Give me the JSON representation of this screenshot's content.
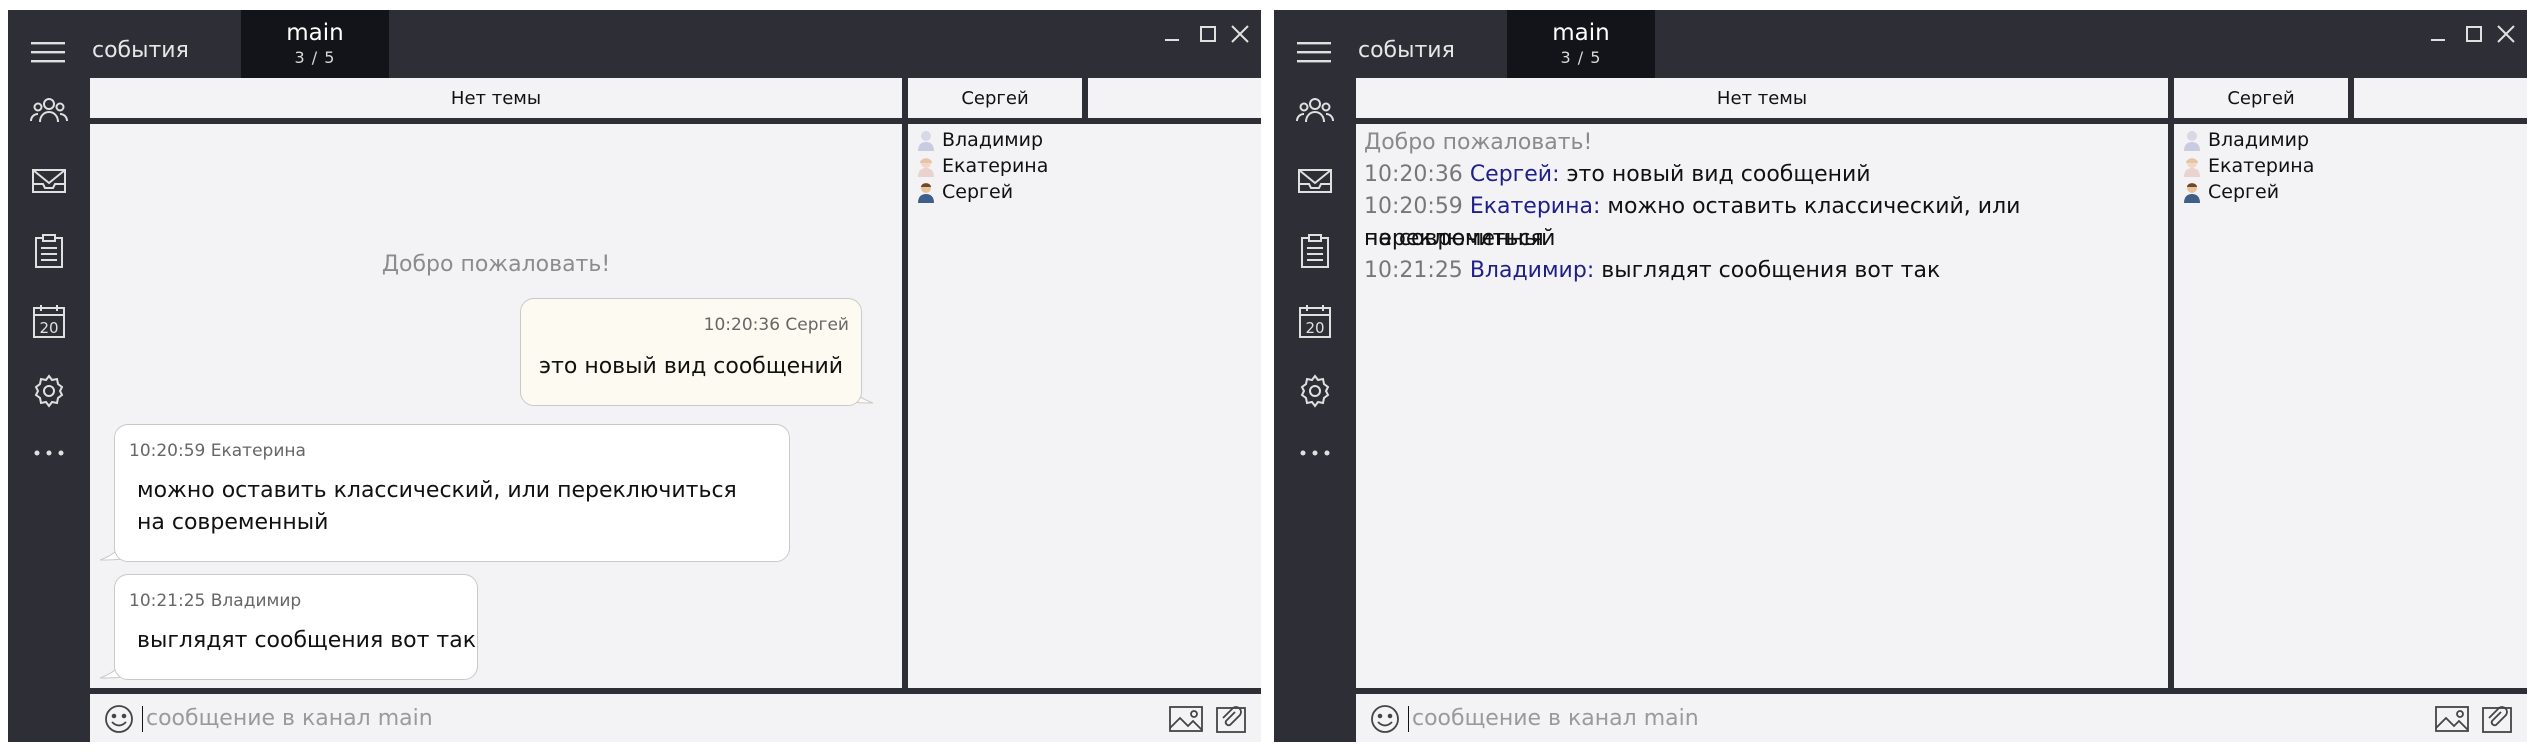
{
  "header": {
    "tab_events": "события",
    "tab_main": "main",
    "tab_main_sub": "3 / 5"
  },
  "topic": "Нет темы",
  "user_header": "Сергей",
  "users": [
    "Владимир",
    "Екатерина",
    "Сергей"
  ],
  "welcome": "Добро пожаловать!",
  "messages": [
    {
      "time": "10:20:36",
      "author": "Сергей",
      "meta": "10:20:36 Сергей",
      "text": "это новый вид сообщений"
    },
    {
      "time": "10:20:59",
      "author": "Екатерина",
      "meta": "10:20:59 Екатерина",
      "text": "можно оставить классический, или переключиться на современный"
    },
    {
      "time": "10:21:25",
      "author": "Владимир",
      "meta": "10:21:25 Владимир",
      "text": "выглядят сообщения вот так"
    }
  ],
  "classic": {
    "l1_time": "10:20:36",
    "l1_nick": "Сергей:",
    "l1_text": " это новый вид сообщений",
    "l2_time": "10:20:59",
    "l2_nick": "Екатерина:",
    "l2_text_a": " можно оставить классический, или переключиться",
    "l2_text_b": "на современный",
    "l3_time": "10:21:25",
    "l3_nick": "Владимир:",
    "l3_text": " выглядят сообщения вот так"
  },
  "input": {
    "placeholder": "сообщение в канал main"
  },
  "icons": {
    "menu": "hamburger-icon",
    "contacts": "users-group-icon",
    "mail": "mail-icon",
    "tasks": "clipboard-icon",
    "calendar": "calendar-icon",
    "calendar_day": "20",
    "settings": "gear-icon",
    "more": "more-icon"
  },
  "colors": {
    "frame": "#2d2e36",
    "active_tab": "#131419",
    "panel": "#f3f3f5",
    "nick": "#1f1f8a",
    "bubble_own": "#fdfbf1"
  }
}
